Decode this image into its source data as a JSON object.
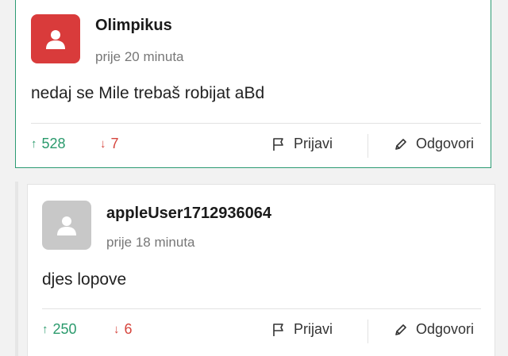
{
  "comments": [
    {
      "username": "Olimpikus",
      "time": "prije 20 minuta",
      "text": "nedaj se Mile trebaš robijat aBd",
      "upvotes": "528",
      "downvotes": "7",
      "avatar_color": "#d93b3b"
    },
    {
      "username": "appleUser1712936064",
      "time": "prije 18 minuta",
      "text": "djes lopove",
      "upvotes": "250",
      "downvotes": "6",
      "avatar_color": "#c8c8c8"
    }
  ],
  "labels": {
    "up_arrow": "↑",
    "down_arrow": "↓",
    "report": "Prijavi",
    "reply": "Odgovori"
  },
  "icons": {
    "avatar": "user-silhouette-icon",
    "report": "flag-icon",
    "reply": "pencil-icon"
  },
  "colors": {
    "accent_green": "#2a9a6c",
    "downvote_red": "#d6453d",
    "card_border_active": "#2c9b73"
  }
}
